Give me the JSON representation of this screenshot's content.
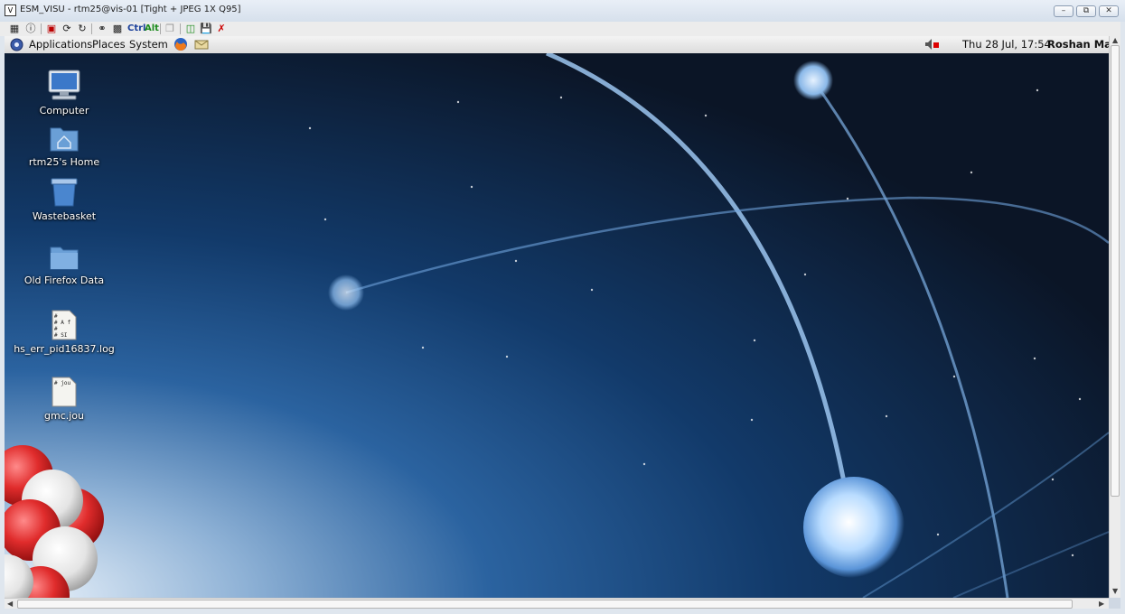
{
  "window": {
    "title": "ESM_VISU - rtm25@vis-01 [Tight + JPEG 1X Q95]",
    "controls": [
      "minimize",
      "restore",
      "close"
    ]
  },
  "vnc_toolbar": {
    "ctrl_label": "Ctrl",
    "alt_label": "Alt"
  },
  "panel": {
    "menus": [
      "Applications",
      "Places",
      "System"
    ],
    "clock": "Thu 28 Jul, 17:54",
    "user": "Roshan Matl"
  },
  "desktop_icons": [
    {
      "label": "Computer",
      "icon": "computer-icon"
    },
    {
      "label": "rtm25's Home",
      "icon": "home-folder-icon"
    },
    {
      "label": "Wastebasket",
      "icon": "trash-icon"
    },
    {
      "label": "Old Firefox Data",
      "icon": "folder-icon"
    },
    {
      "label": "hs_err_pid16837.log",
      "icon": "text-file-icon",
      "preview": [
        "#",
        "# A f",
        "#",
        "# SI"
      ]
    },
    {
      "label": "gmc.jou",
      "icon": "text-file-icon",
      "preview": [
        "# jou"
      ]
    }
  ],
  "colors": {
    "desktop_dark": "#0d1a2e",
    "desktop_blue": "#1c4f86",
    "glow": "#cfe6ff",
    "atom_red": "#d61f26"
  }
}
